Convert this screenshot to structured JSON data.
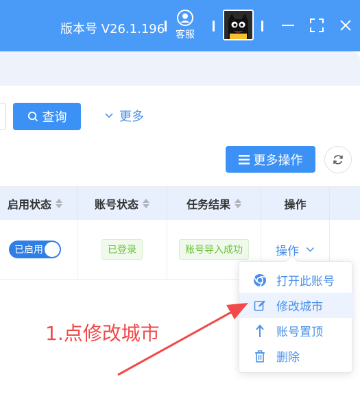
{
  "titlebar": {
    "version": "版本号 V26.1.196",
    "customer_service_label": "客服",
    "accent_color": "#4a9af7"
  },
  "toolbar": {
    "query_label": "查询",
    "more_label": "更多",
    "more_ops_label": "更多操作",
    "primary_color": "#3b91f5"
  },
  "table": {
    "columns": [
      "启用状态",
      "账号状态",
      "任务结果",
      "操作"
    ],
    "rows": [
      {
        "enable_status": "已启用",
        "account_status": "已登录",
        "task_result": "账号导入成功",
        "action": "操作"
      }
    ]
  },
  "action_menu": {
    "items": [
      {
        "label": "打开此账号",
        "icon": "chrome-icon"
      },
      {
        "label": "修改城市",
        "icon": "edit-icon"
      },
      {
        "label": "账号置顶",
        "icon": "arrow-up-icon"
      },
      {
        "label": "删除",
        "icon": "trash-icon"
      }
    ],
    "highlighted_item": "修改城市"
  },
  "annotation": {
    "text": "1.点修改城市",
    "color": "#f04a4a"
  }
}
